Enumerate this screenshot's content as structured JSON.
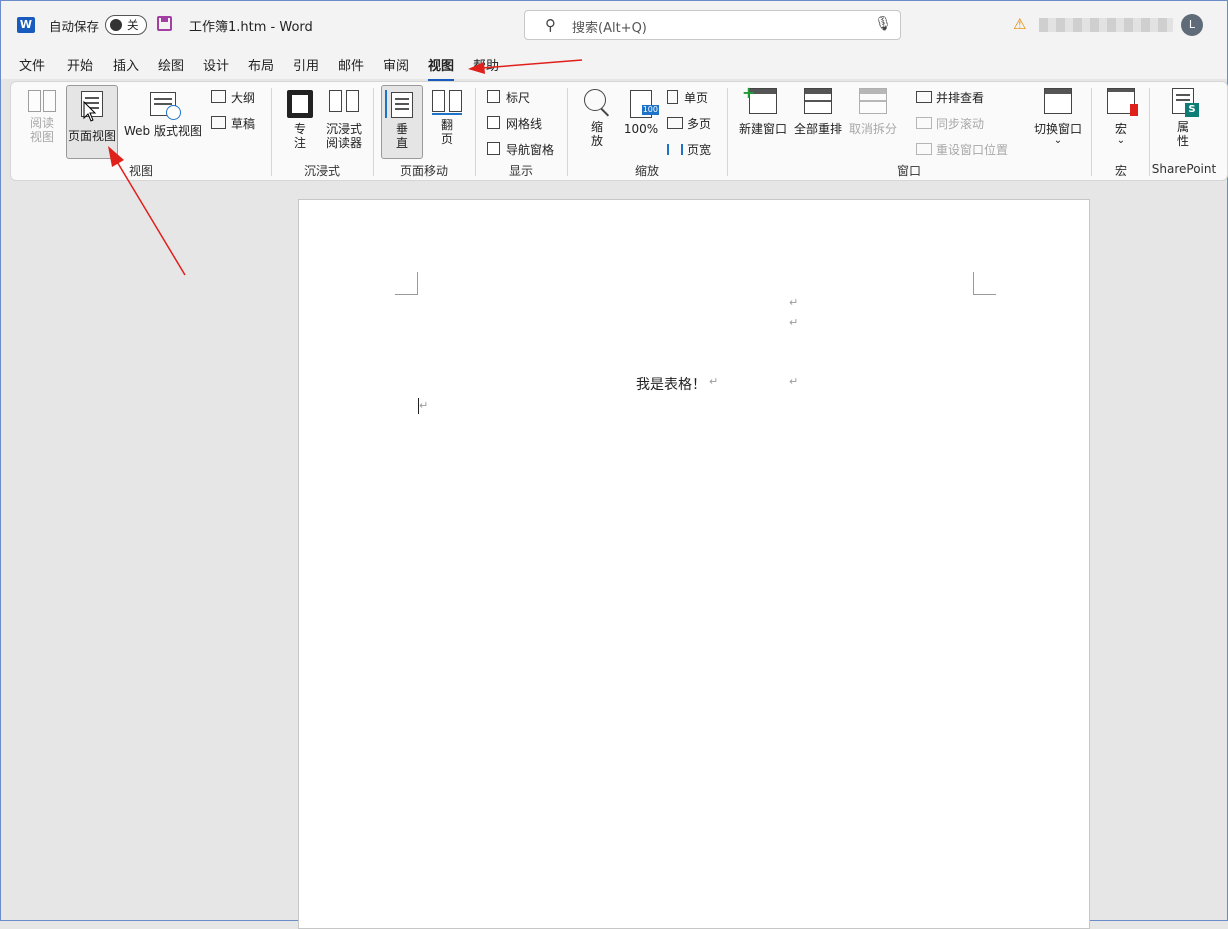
{
  "titlebar": {
    "logo": "W",
    "autosave_label": "自动保存",
    "autosave_state": "关",
    "document_title": "工作簿1.htm  -  Word",
    "search_placeholder": "搜索(Alt+Q)",
    "avatar_initial": "L"
  },
  "tabs": [
    "文件",
    "开始",
    "插入",
    "绘图",
    "设计",
    "布局",
    "引用",
    "邮件",
    "审阅",
    "视图",
    "帮助"
  ],
  "active_tab": "视图",
  "ribbon": {
    "views": {
      "read_mode": "阅读\n视图",
      "print_layout": "页面视图",
      "web_layout": "Web 版式视图",
      "outline": "大纲",
      "draft": "草稿",
      "group": "视图"
    },
    "immersive": {
      "focus_1": "专",
      "focus_2": "注",
      "reader_1": "沉浸式",
      "reader_2": "阅读器",
      "group": "沉浸式"
    },
    "page_movement": {
      "vertical_1": "垂",
      "vertical_2": "直",
      "side_1": "翻",
      "side_2": "页",
      "group": "页面移动"
    },
    "show": {
      "ruler": "标尺",
      "gridlines": "网格线",
      "nav_pane": "导航窗格",
      "group": "显示"
    },
    "zoom": {
      "zoom_1": "缩",
      "zoom_2": "放",
      "hundred": "100%",
      "hundred_badge": "100",
      "one_page": "单页",
      "multi_page": "多页",
      "page_width": "页宽",
      "group": "缩放"
    },
    "window": {
      "new_window": "新建窗口",
      "arrange_all": "全部重排",
      "split": "取消拆分",
      "side_by_side": "并排查看",
      "sync_scroll": "同步滚动",
      "reset_position": "重设窗口位置",
      "switch_windows": "切换窗口",
      "group": "窗口"
    },
    "macros": {
      "label": "宏",
      "group": "宏"
    },
    "sharepoint": {
      "props_1": "属",
      "props_2": "性",
      "group": "SharePoint"
    }
  },
  "document": {
    "text": "我是表格！",
    "para_mark": "↵"
  },
  "colors": {
    "word_blue": "#185abd",
    "annotation_red": "#e0201b"
  }
}
